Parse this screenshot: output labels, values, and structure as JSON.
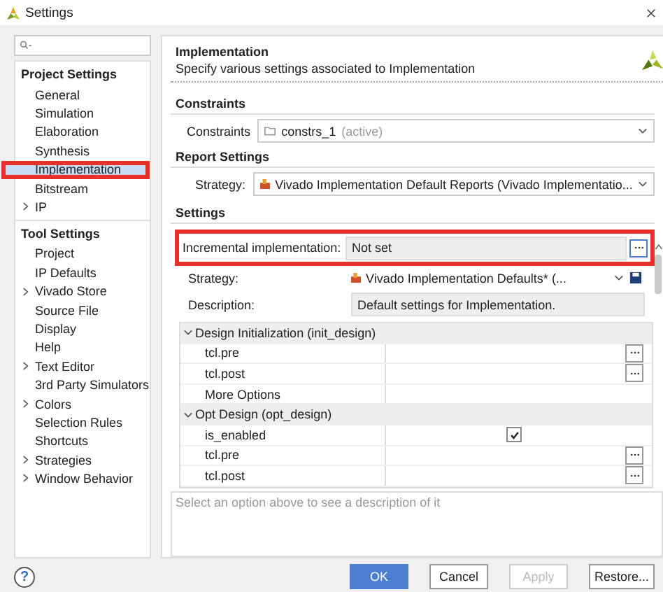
{
  "window": {
    "title": "Settings"
  },
  "sidebar": {
    "sections": [
      {
        "title": "Project Settings",
        "items": [
          {
            "label": "General",
            "expandable": false,
            "selected": false,
            "highlighted": false
          },
          {
            "label": "Simulation",
            "expandable": false,
            "selected": false,
            "highlighted": false
          },
          {
            "label": "Elaboration",
            "expandable": false,
            "selected": false,
            "highlighted": false
          },
          {
            "label": "Synthesis",
            "expandable": false,
            "selected": false,
            "highlighted": false
          },
          {
            "label": "Implementation",
            "expandable": false,
            "selected": true,
            "highlighted": true
          },
          {
            "label": "Bitstream",
            "expandable": false,
            "selected": false,
            "highlighted": false
          },
          {
            "label": "IP",
            "expandable": true,
            "selected": false,
            "highlighted": false
          }
        ]
      },
      {
        "title": "Tool Settings",
        "items": [
          {
            "label": "Project",
            "expandable": false,
            "selected": false,
            "highlighted": false
          },
          {
            "label": "IP Defaults",
            "expandable": false,
            "selected": false,
            "highlighted": false
          },
          {
            "label": "Vivado Store",
            "expandable": true,
            "selected": false,
            "highlighted": false
          },
          {
            "label": "Source File",
            "expandable": false,
            "selected": false,
            "highlighted": false
          },
          {
            "label": "Display",
            "expandable": false,
            "selected": false,
            "highlighted": false
          },
          {
            "label": "Help",
            "expandable": false,
            "selected": false,
            "highlighted": false
          },
          {
            "label": "Text Editor",
            "expandable": true,
            "selected": false,
            "highlighted": false
          },
          {
            "label": "3rd Party Simulators",
            "expandable": false,
            "selected": false,
            "highlighted": false
          },
          {
            "label": "Colors",
            "expandable": true,
            "selected": false,
            "highlighted": false
          },
          {
            "label": "Selection Rules",
            "expandable": false,
            "selected": false,
            "highlighted": false
          },
          {
            "label": "Shortcuts",
            "expandable": false,
            "selected": false,
            "highlighted": false
          },
          {
            "label": "Strategies",
            "expandable": true,
            "selected": false,
            "highlighted": false
          },
          {
            "label": "Window Behavior",
            "expandable": true,
            "selected": false,
            "highlighted": false
          }
        ]
      }
    ]
  },
  "panel": {
    "title": "Implementation",
    "subtitle": "Specify various settings associated to Implementation",
    "constraints": {
      "heading": "Constraints",
      "label": "Constraints",
      "value": "constrs_1",
      "suffix": "(active)"
    },
    "report": {
      "heading": "Report Settings",
      "label": "Strategy:",
      "value": "Vivado Implementation Default Reports (Vivado Implementatio..."
    },
    "settings": {
      "heading": "Settings",
      "incremental": {
        "label": "Incremental implementation:",
        "value": "Not set",
        "highlighted": true
      },
      "strategy": {
        "label": "Strategy:",
        "value": "Vivado Implementation Defaults* (..."
      },
      "description": {
        "label": "Description:",
        "value": "Default settings for Implementation."
      },
      "rows": [
        {
          "kind": "group",
          "label": "Design Initialization (init_design)"
        },
        {
          "kind": "browse",
          "label": "tcl.pre"
        },
        {
          "kind": "browse",
          "label": "tcl.post"
        },
        {
          "kind": "plain",
          "label": "More Options"
        },
        {
          "kind": "group",
          "label": "Opt Design (opt_design)"
        },
        {
          "kind": "check",
          "label": "is_enabled",
          "checked": true
        },
        {
          "kind": "browse",
          "label": "tcl.pre"
        },
        {
          "kind": "browse",
          "label": "tcl.post"
        }
      ],
      "hint": "Select an option above to see a description of it"
    }
  },
  "help": "?",
  "buttons": [
    {
      "label": "OK",
      "kind": "primary",
      "disabled": false
    },
    {
      "label": "Cancel",
      "kind": "normal",
      "disabled": false
    },
    {
      "label": "Apply",
      "kind": "normal",
      "disabled": true
    },
    {
      "label": "Restore...",
      "kind": "normal",
      "disabled": false
    }
  ]
}
